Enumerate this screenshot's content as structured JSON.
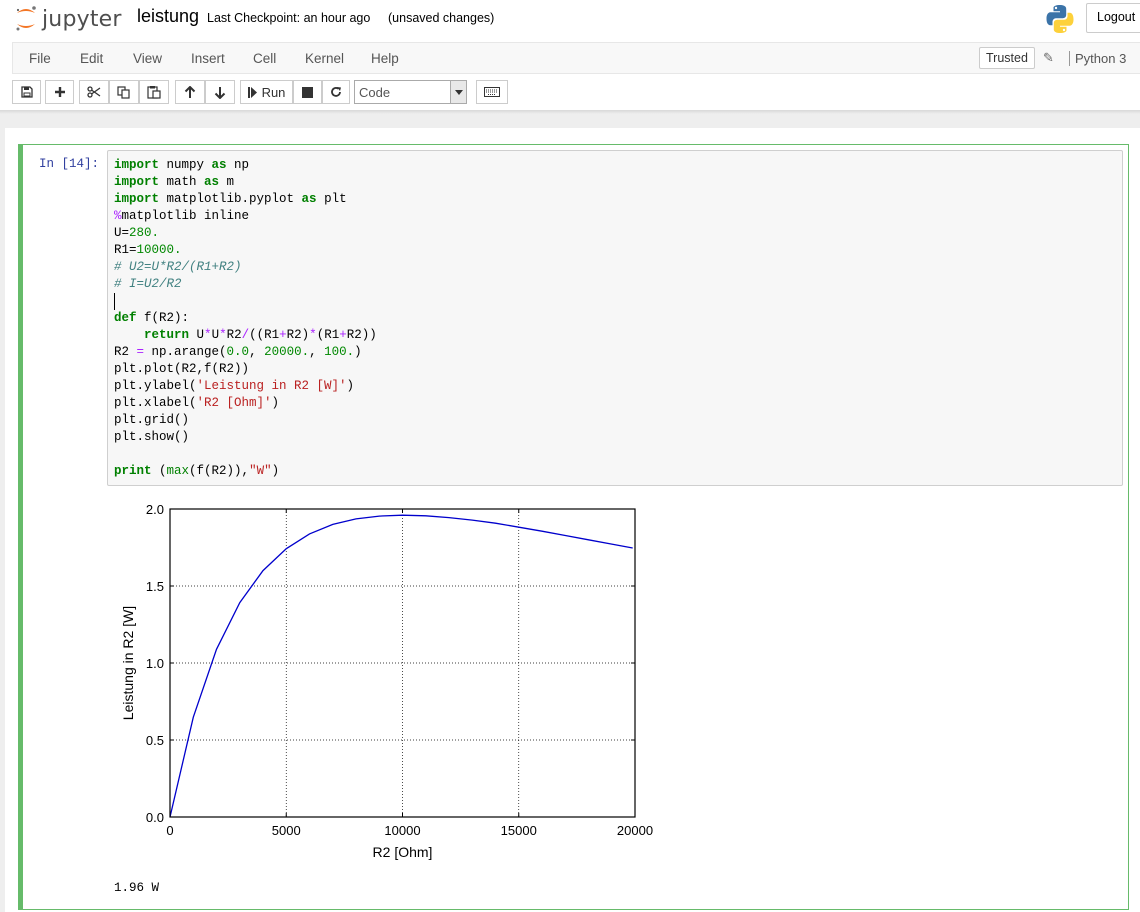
{
  "header": {
    "logo_text": "jupyter",
    "notebook_name": "leistung",
    "checkpoint": "Last Checkpoint: an hour ago",
    "save_status": "(unsaved changes)",
    "logout_label": "Logout"
  },
  "menubar": {
    "items": [
      "File",
      "Edit",
      "View",
      "Insert",
      "Cell",
      "Kernel",
      "Help"
    ],
    "trusted_label": "Trusted",
    "kernel_name": "Python 3"
  },
  "toolbar": {
    "run_label": "Run",
    "cell_type": "Code"
  },
  "cell": {
    "prompt": "In [14]:",
    "output_text": "1.96 W"
  },
  "chart_data": {
    "type": "line",
    "title": "",
    "xlabel": "R2 [Ohm]",
    "ylabel": "Leistung in R2 [W]",
    "xlim": [
      0,
      20000
    ],
    "ylim": [
      0.0,
      2.0
    ],
    "xticks": [
      "0",
      "5000",
      "10000",
      "15000",
      "20000"
    ],
    "yticks": [
      "0.0",
      "0.5",
      "1.0",
      "1.5",
      "2.0"
    ],
    "grid": true,
    "line_color": "#0000cc",
    "series": [
      {
        "x": [
          0,
          1000,
          2000,
          3000,
          4000,
          5000,
          6000,
          7000,
          8000,
          9000,
          10000,
          11000,
          12000,
          13000,
          14000,
          15000,
          16000,
          17000,
          18000,
          19000,
          19900
        ],
        "y": [
          0.0,
          0.648,
          1.089,
          1.392,
          1.6,
          1.742,
          1.838,
          1.9,
          1.936,
          1.954,
          1.96,
          1.956,
          1.944,
          1.928,
          1.908,
          1.882,
          1.856,
          1.828,
          1.8,
          1.772,
          1.747
        ]
      }
    ]
  }
}
